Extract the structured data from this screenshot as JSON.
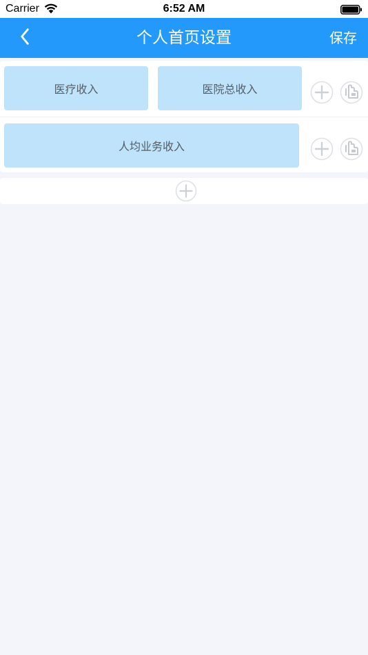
{
  "status_bar": {
    "carrier": "Carrier",
    "time": "6:52 AM",
    "icons": [
      "wifi-icon",
      "battery-icon"
    ]
  },
  "nav": {
    "back_icon": "chevron-left-icon",
    "title": "个人首页设置",
    "save_label": "保存",
    "background_color": "#2299fb"
  },
  "rows": [
    {
      "tiles": [
        {
          "label": "医疗收入"
        },
        {
          "label": "医院总收入"
        }
      ],
      "actions": [
        "plus-circle-icon",
        "drag-handle-icon"
      ]
    },
    {
      "tiles": [
        {
          "label": "人均业务收入"
        }
      ],
      "actions": [
        "plus-circle-icon",
        "drag-handle-icon"
      ]
    }
  ],
  "add_row": {
    "icon": "plus-circle-icon"
  },
  "colors": {
    "tile_background": "#bee3fb",
    "tile_text": "#555d66",
    "page_background": "#f3f5fa",
    "icon_gray": "#d3d6db"
  }
}
